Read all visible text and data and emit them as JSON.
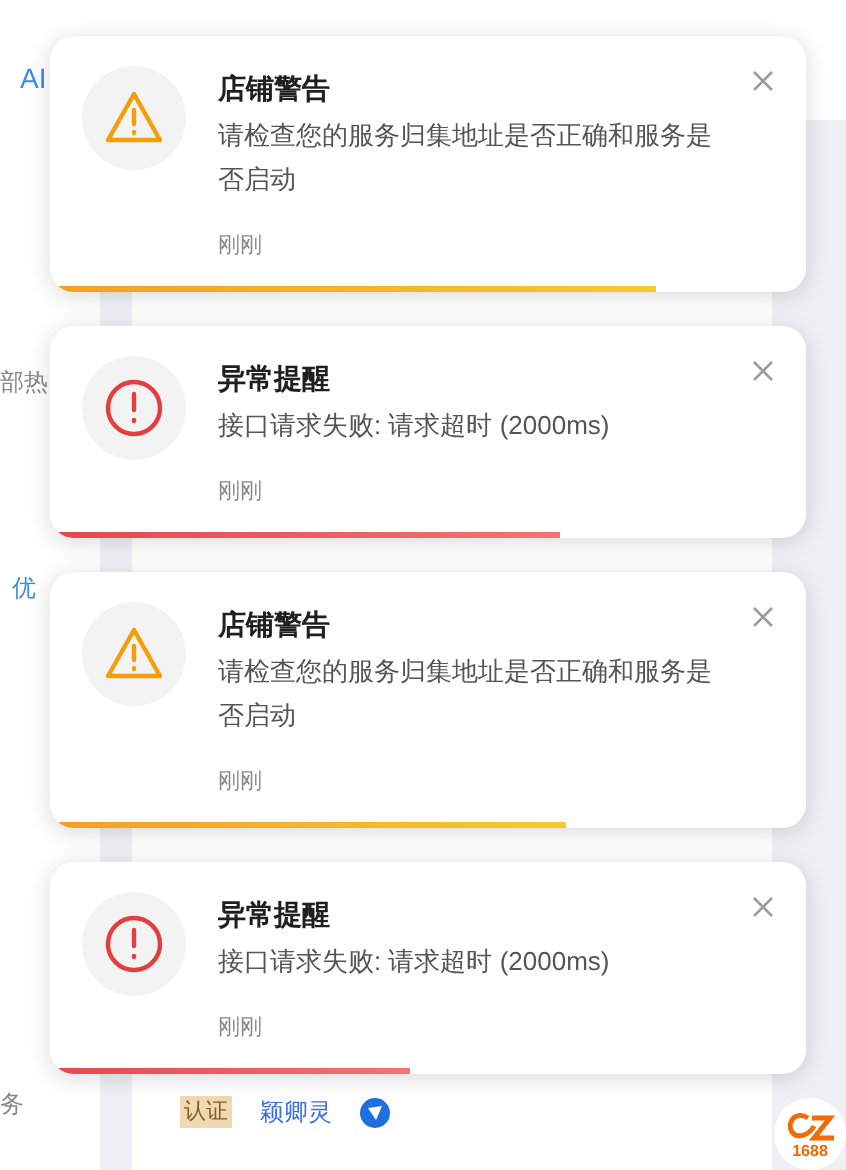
{
  "background": {
    "header_link": "AI",
    "sidebar_texts": [
      "部热",
      "优",
      "务"
    ],
    "card": {
      "badge": "认证",
      "name": "颖卿灵"
    },
    "logo": "1688"
  },
  "notifications": [
    {
      "kind": "warning",
      "title": "店铺警告",
      "message": "请检查您的服务归集地址是否正确和服务是否启动",
      "time": "刚刚",
      "level": 0.8
    },
    {
      "kind": "error",
      "title": "异常提醒",
      "message": "接口请求失败: 请求超时 (2000ms)",
      "time": "刚刚",
      "level": 0.67
    },
    {
      "kind": "warning",
      "title": "店铺警告",
      "message": "请检查您的服务归集地址是否正确和服务是否启动",
      "time": "刚刚",
      "level": 0.68
    },
    {
      "kind": "error",
      "title": "异常提醒",
      "message": "接口请求失败: 请求超时 (2000ms)",
      "time": "刚刚",
      "level": 0.47
    }
  ]
}
